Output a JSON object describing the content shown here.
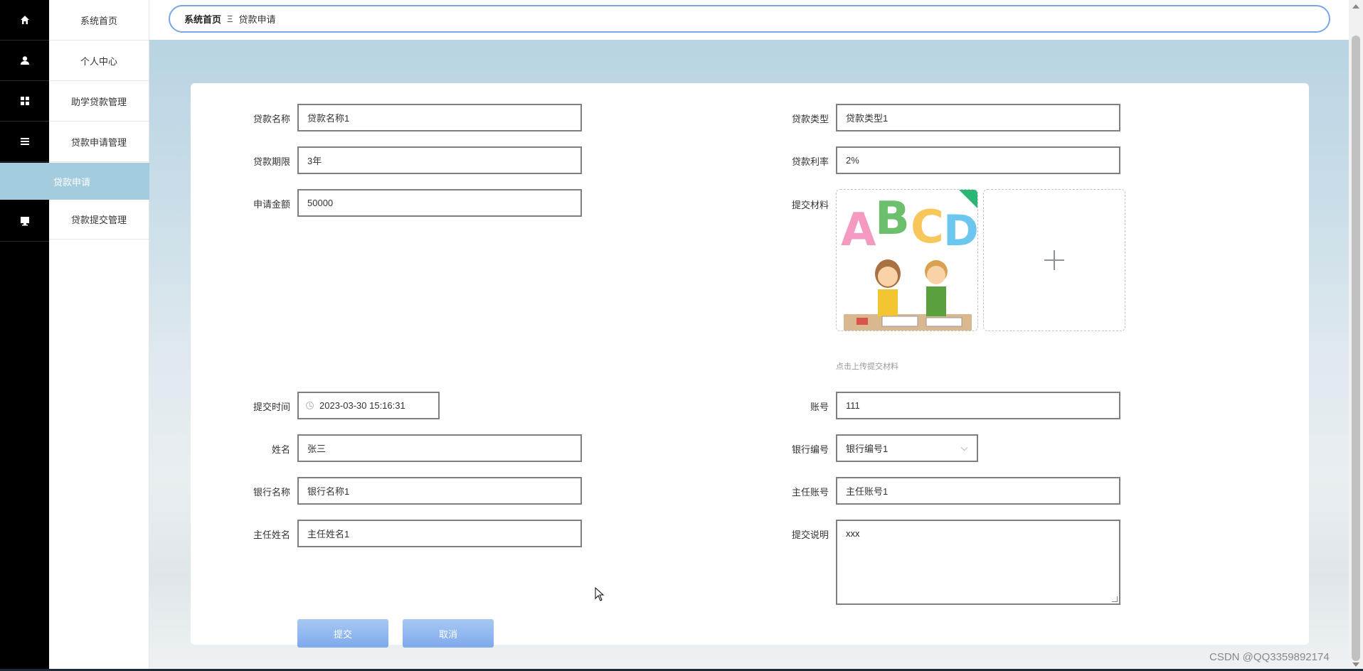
{
  "sidebar": {
    "items": [
      {
        "label": "系统首页",
        "icon": "home-icon"
      },
      {
        "label": "个人中心",
        "icon": "user-icon"
      },
      {
        "label": "助学贷款管理",
        "icon": "grid-icon"
      },
      {
        "label": "贷款申请管理",
        "icon": "list-icon"
      },
      {
        "label": "贷款提交管理",
        "icon": "monitor-icon"
      }
    ],
    "active_sub": "贷款申请"
  },
  "breadcrumb": {
    "home": "系统首页",
    "separator": "Ξ",
    "current": "贷款申请"
  },
  "form": {
    "loan_name": {
      "label": "贷款名称",
      "value": "贷款名称1"
    },
    "loan_type": {
      "label": "贷款类型",
      "value": "贷款类型1"
    },
    "loan_term": {
      "label": "贷款期限",
      "value": "3年"
    },
    "loan_rate": {
      "label": "贷款利率",
      "value": "2%"
    },
    "apply_amount": {
      "label": "申请金额",
      "value": "50000"
    },
    "materials": {
      "label": "提交材料",
      "hint": "点击上传提交材料"
    },
    "submit_time": {
      "label": "提交时间",
      "value": "2023-03-30 15:16:31"
    },
    "account": {
      "label": "账号",
      "value": "111"
    },
    "name": {
      "label": "姓名",
      "value": "张三"
    },
    "bank_code": {
      "label": "银行编号",
      "value": "银行编号1"
    },
    "bank_name": {
      "label": "银行名称",
      "value": "银行名称1"
    },
    "director_account": {
      "label": "主任账号",
      "value": "主任账号1"
    },
    "director_name": {
      "label": "主任姓名",
      "value": "主任姓名1"
    },
    "submit_note": {
      "label": "提交说明",
      "value": "xxx"
    },
    "submit_button": "提交",
    "cancel_button": "取消"
  },
  "watermark": "CSDN @QQ3359892174",
  "colors": {
    "rail": "#000000",
    "active_menu": "#a4ccdf",
    "button": "#7ea9ec",
    "breadcrumb_border": "#7aa6e8"
  }
}
